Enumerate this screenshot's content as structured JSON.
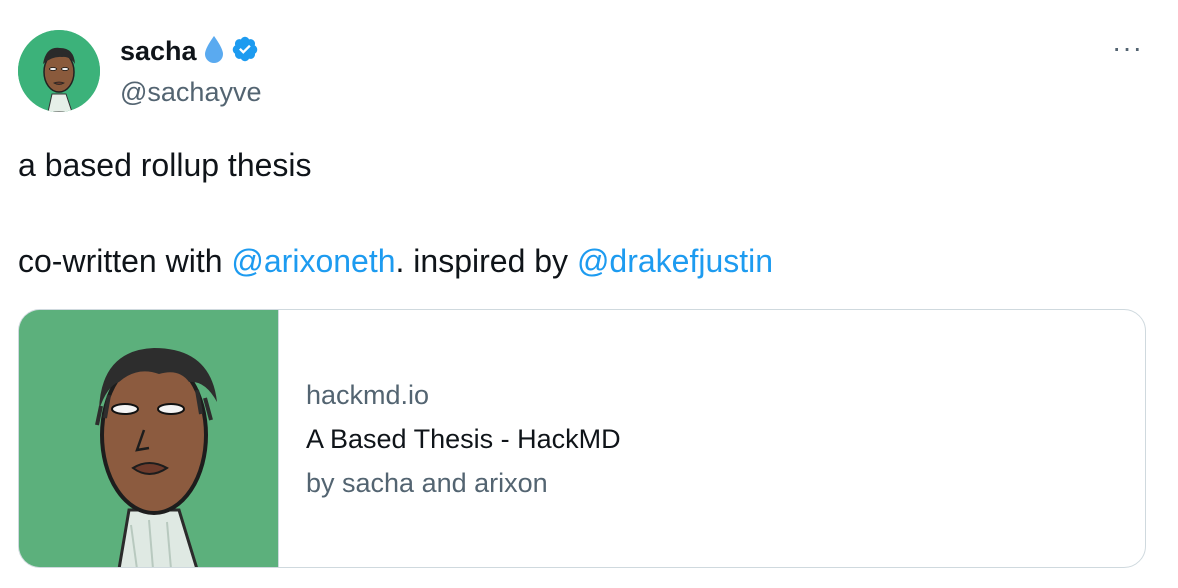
{
  "author": {
    "display_name": "sacha",
    "handle": "@sachayve",
    "emoji_icon": "droplet-icon",
    "verified_icon": "verified-badge-icon",
    "avatar_bg": "#3cb27a"
  },
  "menu": {
    "more_label": "···"
  },
  "tweet": {
    "line1": "a based rollup thesis",
    "line2_prefix": "co-written with ",
    "mention1": "@arixoneth",
    "line2_middle": ". inspired by ",
    "mention2": "@drakefjustin",
    "mention_color": "#1d9bf0"
  },
  "link_card": {
    "domain": "hackmd.io",
    "title": "A Based Thesis - HackMD",
    "description": "by sacha and arixon",
    "image_bg": "#5cb07c"
  }
}
